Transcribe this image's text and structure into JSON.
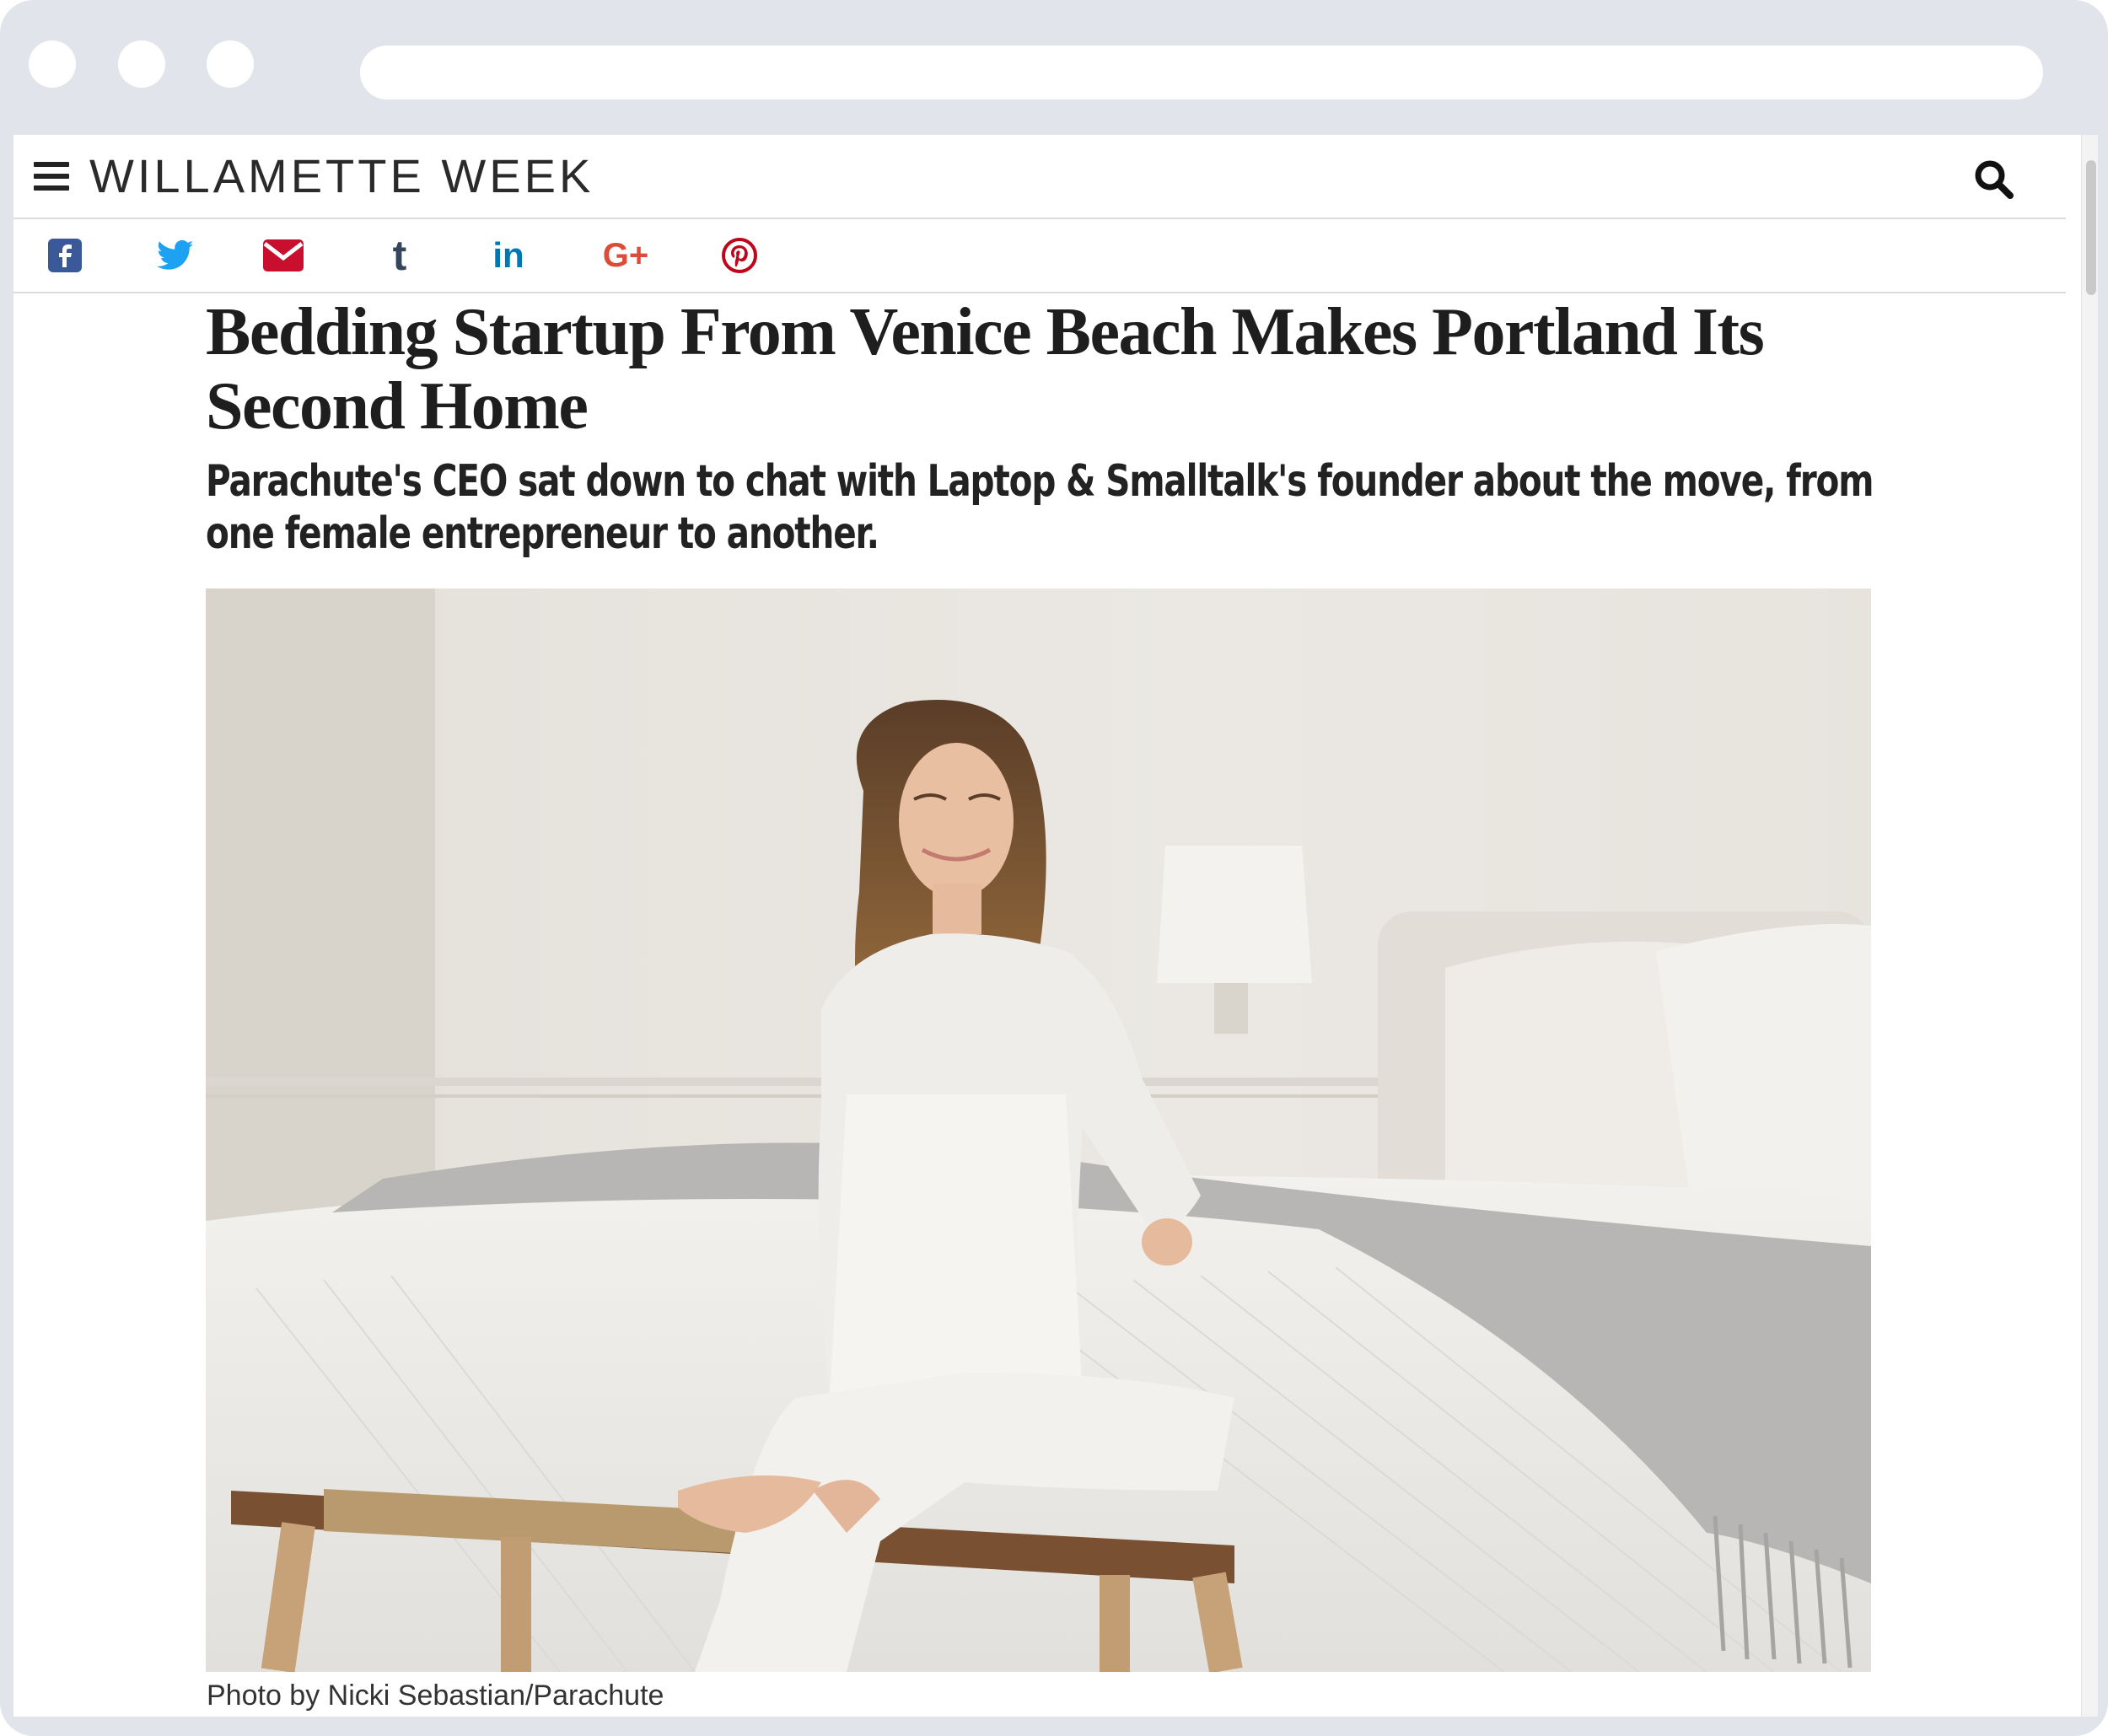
{
  "site": {
    "name": "WILLAMETTE WEEK"
  },
  "share_bar": [
    {
      "icon": "facebook-icon",
      "color": "#3b5998"
    },
    {
      "icon": "twitter-icon",
      "color": "#1da1f2"
    },
    {
      "icon": "email-icon",
      "color": "#c8102e"
    },
    {
      "icon": "tumblr-icon",
      "color": "#35465c",
      "text": "t"
    },
    {
      "icon": "linkedin-icon",
      "color": "#0077b5",
      "text": "in"
    },
    {
      "icon": "google-plus-icon",
      "color": "#dd4b39",
      "text": "G+"
    },
    {
      "icon": "pinterest-icon",
      "color": "#bd081c"
    }
  ],
  "article": {
    "headline": "Bedding Startup From Venice Beach Makes Portland Its Second Home",
    "dek": "Parachute's CEO sat down to chat with Laptop & Smalltalk's founder about the move, from one female entrepreneur to another.",
    "photo_caption": "Photo by Nicki Sebastian/Parachute"
  },
  "colors": {
    "frame": "#e1e4ea",
    "headline": "#1e1e1e"
  }
}
